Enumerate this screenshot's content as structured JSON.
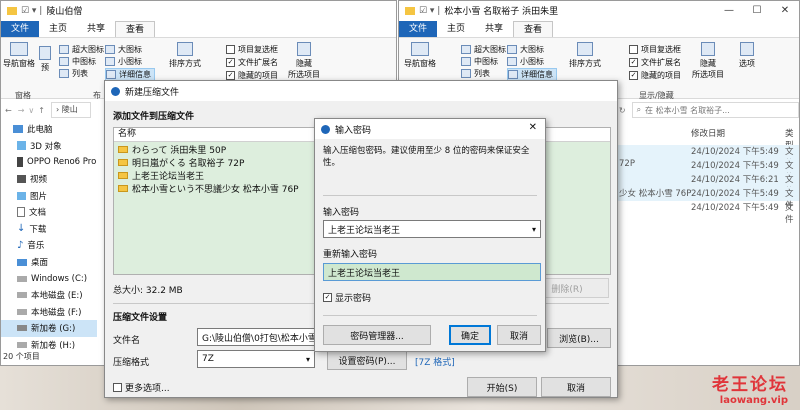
{
  "explorer_left": {
    "title": "陵山伯僧",
    "tabs": [
      "文件",
      "主页",
      "共享",
      "查看"
    ],
    "ribbon": {
      "nav_pane": "导航窗格",
      "preview": "预",
      "layouts": [
        "超大图标",
        "大图标",
        "中图标",
        "小图标",
        "列表",
        "详细信息"
      ],
      "sort": "排序方式",
      "item_checkbox": "项目复选框",
      "file_ext": "文件扩展名",
      "hidden_items": "隐藏的项目",
      "hide": "隐藏",
      "hide_selected": "所选项目",
      "group_pane": "窗格",
      "group_layout": "布"
    },
    "address_path": "陵山",
    "tree": [
      "此电脑",
      "3D 对象",
      "OPPO Reno6 Pro",
      "视频",
      "图片",
      "文档",
      "下载",
      "音乐",
      "桌面",
      "Windows (C:)",
      "本地磁盘 (E:)",
      "本地磁盘 (F:)",
      "新加卷 (G:)",
      "新加卷 (H:)"
    ],
    "status": "20 个项目"
  },
  "explorer_right": {
    "title": "松本小雪 名取裕子 浜田朱里",
    "tabs": [
      "文件",
      "主页",
      "共享",
      "查看"
    ],
    "ribbon": {
      "nav_pane": "导航窗格",
      "layouts": [
        "超大图标",
        "大图标",
        "中图标",
        "小图标",
        "列表",
        "详细信息"
      ],
      "sort": "排序方式",
      "item_checkbox": "项目复选框",
      "file_ext": "文件扩展名",
      "hidden_items": "隐藏的项目",
      "hide": "隐藏",
      "hide_selected": "所选项目",
      "options": "选项",
      "group_show": "显示/隐藏"
    },
    "search_placeholder": "在 松本小雪 名取裕子...",
    "columns": [
      "修改日期",
      "类型"
    ],
    "rows": [
      {
        "name": "",
        "date": "24/10/2024 下午5:49",
        "type": "文件"
      },
      {
        "name": "72P",
        "date": "24/10/2024 下午5:49",
        "type": "文件"
      },
      {
        "name": "",
        "date": "24/10/2024 下午6:21",
        "type": "文件"
      },
      {
        "name": "少女 松本小雪 76P",
        "date": "24/10/2024 下午5:49",
        "type": "文件"
      },
      {
        "name": "",
        "date": "24/10/2024 下午5:49",
        "type": "文件"
      }
    ]
  },
  "archive_dialog": {
    "title": "新建压缩文件",
    "add_section": "添加文件到压缩文件",
    "col_name": "名称",
    "files": [
      "わらって 浜田朱里 50P",
      "明日嵐がくる 名取裕子 72P",
      "上老王论坛当老王",
      "松本小雪という不思議少女 松本小雪 76P"
    ],
    "total_size": "总大小: 32.2 MB",
    "remove_btn": "删除(R)",
    "settings_section": "压缩文件设置",
    "filename_label": "文件名",
    "filename_value": "G:\\陵山伯僧\\0打包\\松本小雪 名",
    "browse_btn": "浏览(B)...",
    "format_label": "压缩格式",
    "format_value": "7Z",
    "set_password_btn": "设置密码(P)...",
    "format_link": "[7Z 格式]",
    "more_options": "更多选项...",
    "start_btn": "开始(S)",
    "cancel_btn": "取消"
  },
  "password_dialog": {
    "title": "输入密码",
    "prompt": "输入压缩包密码。建议使用至少 8 位的密码来保证安全性。",
    "enter_label": "输入密码",
    "enter_value": "上老王论坛当老王",
    "reenter_label": "重新输入密码",
    "reenter_value": "上老王论坛当老王",
    "show_password": "显示密码",
    "manager_btn": "密码管理器...",
    "ok_btn": "确定",
    "cancel_btn": "取消"
  },
  "watermark": {
    "line1": "老王论坛",
    "line2": "laowang.vip"
  }
}
